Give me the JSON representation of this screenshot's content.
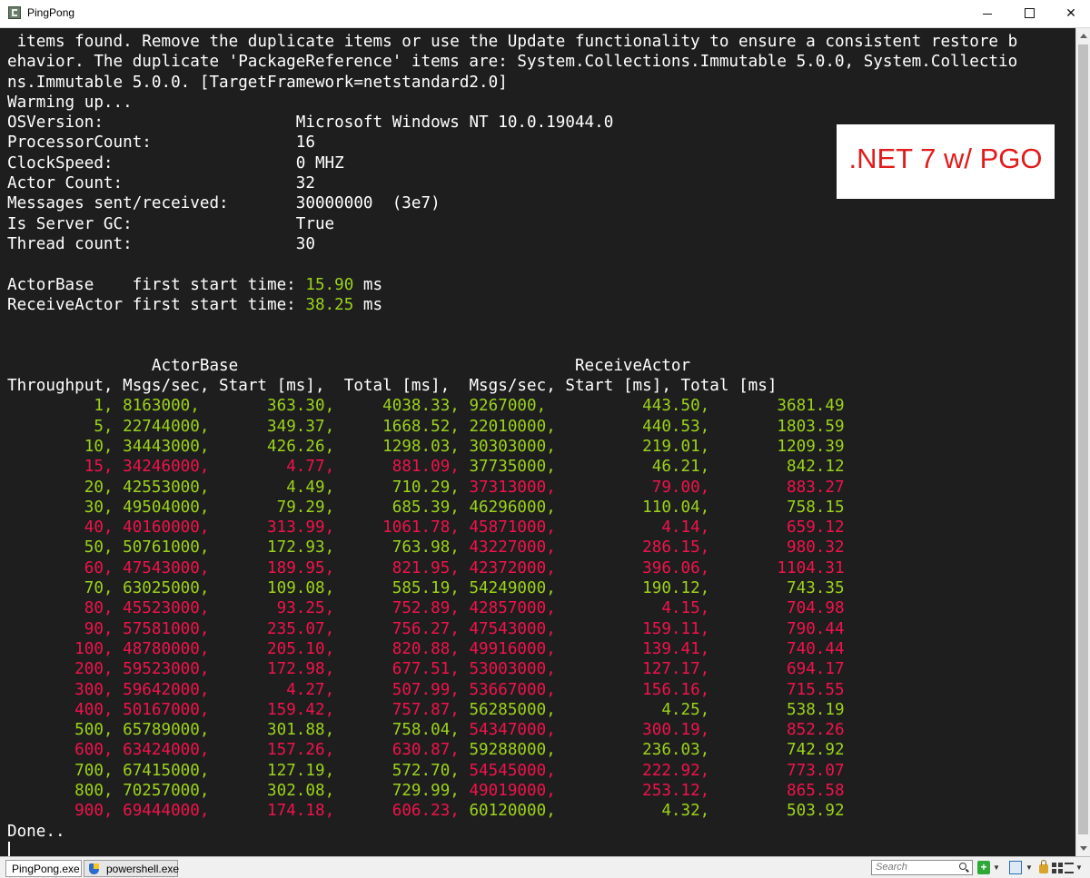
{
  "window": {
    "title": "PingPong",
    "minimize_glyph": "",
    "close_glyph": "✕"
  },
  "overlay_label": ".NET 7 w/ PGO",
  "console": {
    "warning_lines": [
      " items found. Remove the duplicate items or use the Update functionality to ensure a consistent restore b",
      "ehavior. The duplicate 'PackageReference' items are: System.Collections.Immutable 5.0.0, System.Collectio",
      "ns.Immutable 5.0.0. [TargetFramework=netstandard2.0]"
    ],
    "warming": "Warming up...",
    "info": [
      {
        "key": "OSVersion:",
        "value": "Microsoft Windows NT 10.0.19044.0"
      },
      {
        "key": "ProcessorCount:",
        "value": "16"
      },
      {
        "key": "ClockSpeed:",
        "value": "0 MHZ"
      },
      {
        "key": "Actor Count:",
        "value": "32"
      },
      {
        "key": "Messages sent/received:",
        "value": "30000000  (3e7)"
      },
      {
        "key": "Is Server GC:",
        "value": "True"
      },
      {
        "key": "Thread count:",
        "value": "30"
      }
    ],
    "start_times": [
      {
        "label": "ActorBase    first start time: ",
        "value": "15.90",
        "unit": " ms"
      },
      {
        "label": "ReceiveActor first start time: ",
        "value": "38.25",
        "unit": " ms"
      }
    ],
    "group_headers": [
      "ActorBase",
      "ReceiveActor"
    ],
    "columns": [
      "Throughput,",
      "Msgs/sec,",
      "Start [ms],",
      "Total [ms],",
      "Msgs/sec,",
      "Start [ms],",
      "Total [ms]"
    ],
    "rows": [
      {
        "throughput": "1",
        "c": "g",
        "a_msgs": "8163000",
        "ac": "g",
        "a_start": "363.30",
        "asc": "g",
        "a_total": "4038.33",
        "atc": "g",
        "r_msgs": "9267000",
        "rc": "g",
        "r_start": "443.50",
        "rsc": "g",
        "r_total": "3681.49",
        "rtc": "g"
      },
      {
        "throughput": "5",
        "c": "g",
        "a_msgs": "22744000",
        "ac": "g",
        "a_start": "349.37",
        "asc": "g",
        "a_total": "1668.52",
        "atc": "g",
        "r_msgs": "22010000",
        "rc": "g",
        "r_start": "440.53",
        "rsc": "g",
        "r_total": "1803.59",
        "rtc": "g"
      },
      {
        "throughput": "10",
        "c": "g",
        "a_msgs": "34443000",
        "ac": "g",
        "a_start": "426.26",
        "asc": "g",
        "a_total": "1298.03",
        "atc": "g",
        "r_msgs": "30303000",
        "rc": "g",
        "r_start": "219.01",
        "rsc": "g",
        "r_total": "1209.39",
        "rtc": "g"
      },
      {
        "throughput": "15",
        "c": "r",
        "a_msgs": "34246000",
        "ac": "r",
        "a_start": "4.77",
        "asc": "r",
        "a_total": "881.09",
        "atc": "r",
        "r_msgs": "37735000",
        "rc": "g",
        "r_start": "46.21",
        "rsc": "g",
        "r_total": "842.12",
        "rtc": "g"
      },
      {
        "throughput": "20",
        "c": "g",
        "a_msgs": "42553000",
        "ac": "g",
        "a_start": "4.49",
        "asc": "g",
        "a_total": "710.29",
        "atc": "g",
        "r_msgs": "37313000",
        "rc": "r",
        "r_start": "79.00",
        "rsc": "r",
        "r_total": "883.27",
        "rtc": "r"
      },
      {
        "throughput": "30",
        "c": "g",
        "a_msgs": "49504000",
        "ac": "g",
        "a_start": "79.29",
        "asc": "g",
        "a_total": "685.39",
        "atc": "g",
        "r_msgs": "46296000",
        "rc": "g",
        "r_start": "110.04",
        "rsc": "g",
        "r_total": "758.15",
        "rtc": "g"
      },
      {
        "throughput": "40",
        "c": "r",
        "a_msgs": "40160000",
        "ac": "r",
        "a_start": "313.99",
        "asc": "r",
        "a_total": "1061.78",
        "atc": "r",
        "r_msgs": "45871000",
        "rc": "r",
        "r_start": "4.14",
        "rsc": "r",
        "r_total": "659.12",
        "rtc": "r"
      },
      {
        "throughput": "50",
        "c": "g",
        "a_msgs": "50761000",
        "ac": "g",
        "a_start": "172.93",
        "asc": "g",
        "a_total": "763.98",
        "atc": "g",
        "r_msgs": "43227000",
        "rc": "r",
        "r_start": "286.15",
        "rsc": "r",
        "r_total": "980.32",
        "rtc": "r"
      },
      {
        "throughput": "60",
        "c": "r",
        "a_msgs": "47543000",
        "ac": "r",
        "a_start": "189.95",
        "asc": "r",
        "a_total": "821.95",
        "atc": "r",
        "r_msgs": "42372000",
        "rc": "r",
        "r_start": "396.06",
        "rsc": "r",
        "r_total": "1104.31",
        "rtc": "r"
      },
      {
        "throughput": "70",
        "c": "g",
        "a_msgs": "63025000",
        "ac": "g",
        "a_start": "109.08",
        "asc": "g",
        "a_total": "585.19",
        "atc": "g",
        "r_msgs": "54249000",
        "rc": "g",
        "r_start": "190.12",
        "rsc": "g",
        "r_total": "743.35",
        "rtc": "g"
      },
      {
        "throughput": "80",
        "c": "r",
        "a_msgs": "45523000",
        "ac": "r",
        "a_start": "93.25",
        "asc": "r",
        "a_total": "752.89",
        "atc": "r",
        "r_msgs": "42857000",
        "rc": "r",
        "r_start": "4.15",
        "rsc": "r",
        "r_total": "704.98",
        "rtc": "r"
      },
      {
        "throughput": "90",
        "c": "r",
        "a_msgs": "57581000",
        "ac": "r",
        "a_start": "235.07",
        "asc": "r",
        "a_total": "756.27",
        "atc": "r",
        "r_msgs": "47543000",
        "rc": "r",
        "r_start": "159.11",
        "rsc": "r",
        "r_total": "790.44",
        "rtc": "r"
      },
      {
        "throughput": "100",
        "c": "r",
        "a_msgs": "48780000",
        "ac": "r",
        "a_start": "205.10",
        "asc": "r",
        "a_total": "820.88",
        "atc": "r",
        "r_msgs": "49916000",
        "rc": "r",
        "r_start": "139.41",
        "rsc": "r",
        "r_total": "740.44",
        "rtc": "r"
      },
      {
        "throughput": "200",
        "c": "r",
        "a_msgs": "59523000",
        "ac": "r",
        "a_start": "172.98",
        "asc": "r",
        "a_total": "677.51",
        "atc": "r",
        "r_msgs": "53003000",
        "rc": "r",
        "r_start": "127.17",
        "rsc": "r",
        "r_total": "694.17",
        "rtc": "r"
      },
      {
        "throughput": "300",
        "c": "r",
        "a_msgs": "59642000",
        "ac": "r",
        "a_start": "4.27",
        "asc": "r",
        "a_total": "507.99",
        "atc": "r",
        "r_msgs": "53667000",
        "rc": "r",
        "r_start": "156.16",
        "rsc": "r",
        "r_total": "715.55",
        "rtc": "r"
      },
      {
        "throughput": "400",
        "c": "r",
        "a_msgs": "50167000",
        "ac": "r",
        "a_start": "159.42",
        "asc": "r",
        "a_total": "757.87",
        "atc": "r",
        "r_msgs": "56285000",
        "rc": "g",
        "r_start": "4.25",
        "rsc": "g",
        "r_total": "538.19",
        "rtc": "g"
      },
      {
        "throughput": "500",
        "c": "g",
        "a_msgs": "65789000",
        "ac": "g",
        "a_start": "301.88",
        "asc": "g",
        "a_total": "758.04",
        "atc": "g",
        "r_msgs": "54347000",
        "rc": "r",
        "r_start": "300.19",
        "rsc": "r",
        "r_total": "852.26",
        "rtc": "r"
      },
      {
        "throughput": "600",
        "c": "r",
        "a_msgs": "63424000",
        "ac": "r",
        "a_start": "157.26",
        "asc": "r",
        "a_total": "630.87",
        "atc": "r",
        "r_msgs": "59288000",
        "rc": "g",
        "r_start": "236.03",
        "rsc": "g",
        "r_total": "742.92",
        "rtc": "g"
      },
      {
        "throughput": "700",
        "c": "g",
        "a_msgs": "67415000",
        "ac": "g",
        "a_start": "127.19",
        "asc": "g",
        "a_total": "572.70",
        "atc": "g",
        "r_msgs": "54545000",
        "rc": "r",
        "r_start": "222.92",
        "rsc": "r",
        "r_total": "773.07",
        "rtc": "r"
      },
      {
        "throughput": "800",
        "c": "g",
        "a_msgs": "70257000",
        "ac": "g",
        "a_start": "302.08",
        "asc": "g",
        "a_total": "729.99",
        "atc": "g",
        "r_msgs": "49019000",
        "rc": "r",
        "r_start": "253.12",
        "rsc": "r",
        "r_total": "865.58",
        "rtc": "r"
      },
      {
        "throughput": "900",
        "c": "r",
        "a_msgs": "69444000",
        "ac": "r",
        "a_start": "174.18",
        "asc": "r",
        "a_total": "606.23",
        "atc": "r",
        "r_msgs": "60120000",
        "rc": "g",
        "r_start": "4.32",
        "rsc": "g",
        "r_total": "503.92",
        "rtc": "g"
      }
    ],
    "done": "Done.."
  },
  "colors": {
    "green": "#9bd31b",
    "red": "#f0134b",
    "white": "#ffffff",
    "background": "#1e1e1e"
  },
  "taskbar": {
    "items": [
      "PingPong.exe",
      "powershell.exe"
    ],
    "search_placeholder": "Search",
    "add_glyph": "+",
    "dropdown_glyph": "▼"
  }
}
